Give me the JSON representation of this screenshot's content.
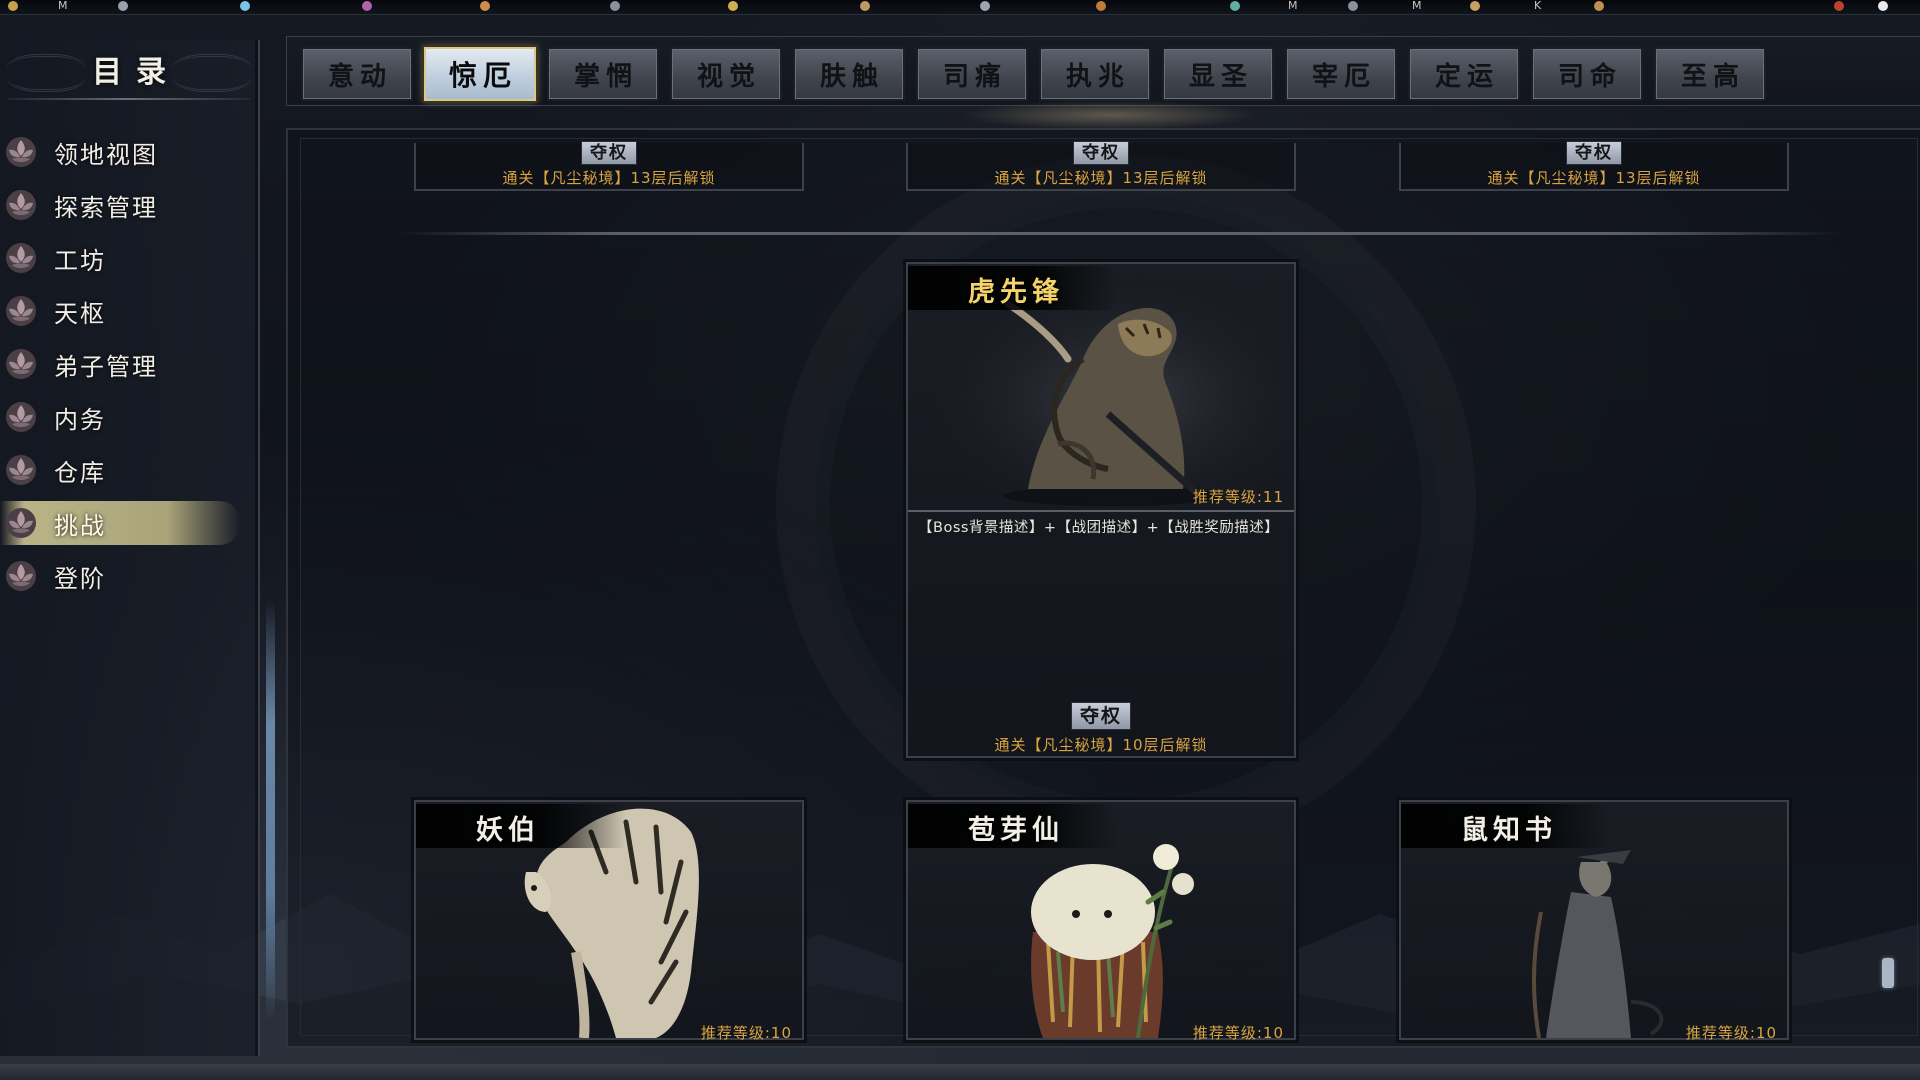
{
  "hud": {
    "marks": [
      "M",
      "M",
      "M",
      "K"
    ]
  },
  "sidebar": {
    "title": "目录",
    "items": [
      {
        "label": "领地视图",
        "active": false
      },
      {
        "label": "探索管理",
        "active": false
      },
      {
        "label": "工坊",
        "active": false
      },
      {
        "label": "天枢",
        "active": false
      },
      {
        "label": "弟子管理",
        "active": false
      },
      {
        "label": "内务",
        "active": false
      },
      {
        "label": "仓库",
        "active": false
      },
      {
        "label": "挑战",
        "active": true
      },
      {
        "label": "登阶",
        "active": false
      }
    ]
  },
  "tabs": [
    {
      "label": "意动",
      "active": false
    },
    {
      "label": "惊厄",
      "active": true
    },
    {
      "label": "掌惘",
      "active": false
    },
    {
      "label": "视觉",
      "active": false
    },
    {
      "label": "肤触",
      "active": false
    },
    {
      "label": "司痛",
      "active": false
    },
    {
      "label": "执兆",
      "active": false
    },
    {
      "label": "显圣",
      "active": false
    },
    {
      "label": "宰厄",
      "active": false
    },
    {
      "label": "定运",
      "active": false
    },
    {
      "label": "司命",
      "active": false
    },
    {
      "label": "至高",
      "active": false
    }
  ],
  "top_locked": [
    {
      "badge": "夺权",
      "unlock_text": "通关【凡尘秘境】13层后解锁"
    },
    {
      "badge": "夺权",
      "unlock_text": "通关【凡尘秘境】13层后解锁"
    },
    {
      "badge": "夺权",
      "unlock_text": "通关【凡尘秘境】13层后解锁"
    }
  ],
  "featured_boss": {
    "name": "虎先锋",
    "recommended_level": "推荐等级:11",
    "description": "【Boss背景描述】+【战团描述】+【战胜奖励描述】",
    "badge": "夺权",
    "unlock_text": "通关【凡尘秘境】10层后解锁",
    "name_color": "#f3d36a"
  },
  "bosses": [
    {
      "name": "妖伯",
      "recommended_level": "推荐等级:10"
    },
    {
      "name": "苞芽仙",
      "recommended_level": "推荐等级:10"
    },
    {
      "name": "鼠知书",
      "recommended_level": "推荐等级:10"
    }
  ],
  "colors": {
    "accent_gold": "#d9a441",
    "active_nav": "#b9b487",
    "active_tab": "#bfcfdf",
    "panel_bg": "#12151d"
  }
}
